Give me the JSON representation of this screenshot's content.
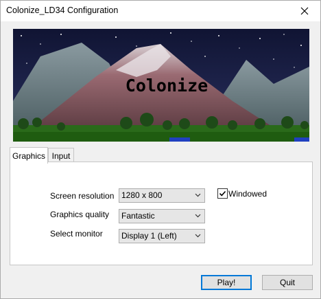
{
  "window": {
    "title": "Colonize_LD34 Configuration"
  },
  "banner": {
    "title": "Colonize"
  },
  "tabs": [
    {
      "label": "Graphics"
    },
    {
      "label": "Input"
    }
  ],
  "graphics": {
    "screen_resolution": {
      "label": "Screen resolution",
      "value": "1280 x 800"
    },
    "graphics_quality": {
      "label": "Graphics quality",
      "value": "Fantastic"
    },
    "select_monitor": {
      "label": "Select monitor",
      "value": "Display 1 (Left)"
    },
    "windowed": {
      "label": "Windowed",
      "checked": true
    }
  },
  "buttons": {
    "play": "Play!",
    "quit": "Quit"
  },
  "icons": {
    "close": "close-icon",
    "dropdown": "chevron-down-icon",
    "check": "checkmark-icon"
  },
  "colors": {
    "accent": "#0078d7",
    "sky": "#151a3e",
    "banner_text": "#000000"
  }
}
